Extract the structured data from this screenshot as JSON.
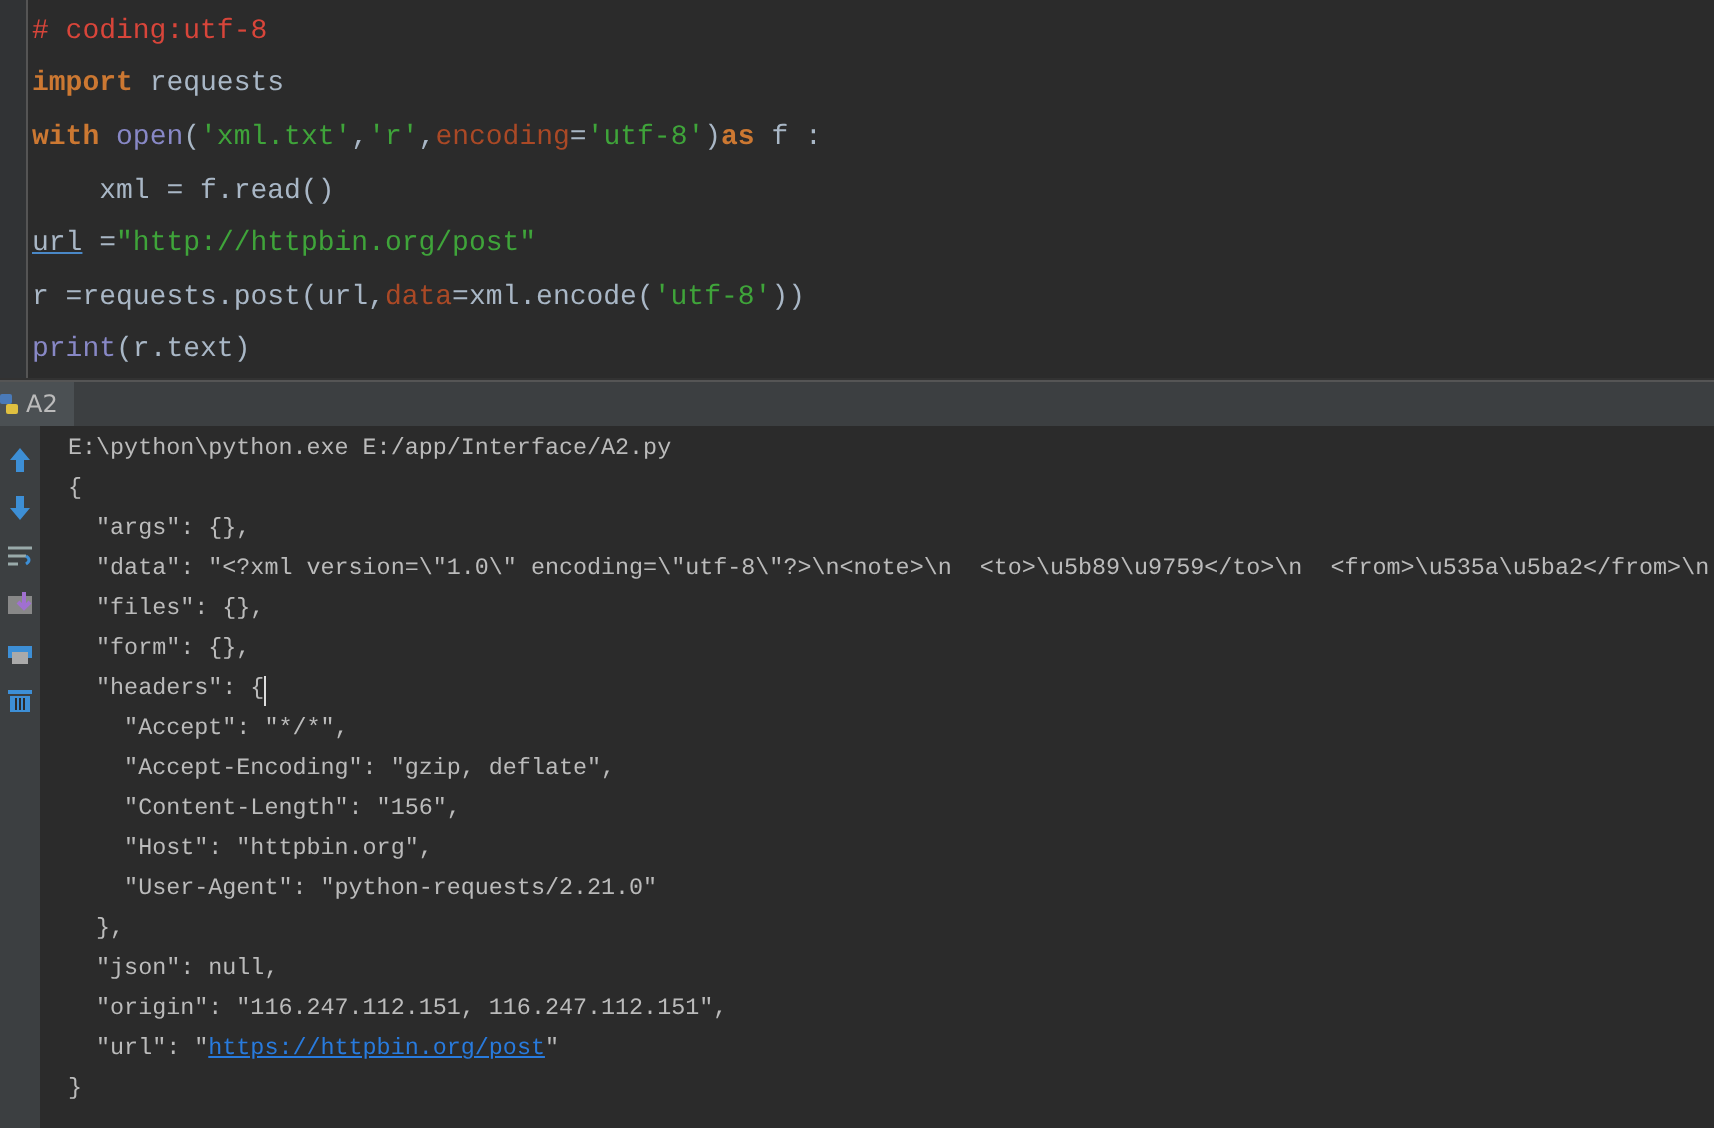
{
  "editor": {
    "lines": [
      [
        {
          "kind": "comment",
          "text": "# coding:utf-8"
        }
      ],
      [
        {
          "kind": "keyword",
          "text": "import"
        },
        {
          "kind": "plain",
          "text": " requests"
        }
      ],
      [
        {
          "kind": "keyword",
          "text": "with"
        },
        {
          "kind": "builtin",
          "text": " open"
        },
        {
          "kind": "plain",
          "text": "("
        },
        {
          "kind": "string",
          "text": "'xml.txt'"
        },
        {
          "kind": "plain",
          "text": ","
        },
        {
          "kind": "string",
          "text": "'r'"
        },
        {
          "kind": "plain",
          "text": ","
        },
        {
          "kind": "param",
          "text": "encoding"
        },
        {
          "kind": "plain",
          "text": "="
        },
        {
          "kind": "string",
          "text": "'utf-8'"
        },
        {
          "kind": "plain",
          "text": ")"
        },
        {
          "kind": "keyword",
          "text": "as"
        },
        {
          "kind": "plain",
          "text": " f :"
        }
      ],
      [
        {
          "kind": "plain",
          "text": "    xml = f.read()"
        }
      ],
      [
        {
          "kind": "warning",
          "text": "url"
        },
        {
          "kind": "plain",
          "text": " ="
        },
        {
          "kind": "string",
          "text": "\"http://httpbin.org/post\""
        }
      ],
      [
        {
          "kind": "plain",
          "text": "r =requests.post(url,"
        },
        {
          "kind": "param",
          "text": "data"
        },
        {
          "kind": "plain",
          "text": "=xml.encode("
        },
        {
          "kind": "string",
          "text": "'utf-8'"
        },
        {
          "kind": "plain",
          "text": "))"
        }
      ],
      [
        {
          "kind": "builtin",
          "text": "print"
        },
        {
          "kind": "plain",
          "text": "(r.text)"
        }
      ]
    ]
  },
  "run_panel": {
    "tab": {
      "label": "A2",
      "selected": true
    },
    "lines": [
      {
        "cursor": false,
        "parts": [
          {
            "kind": "text",
            "text": "E:\\python\\python.exe E:/app/Interface/A2.py"
          }
        ]
      },
      {
        "cursor": false,
        "parts": [
          {
            "kind": "text",
            "text": "{"
          }
        ]
      },
      {
        "cursor": false,
        "parts": [
          {
            "kind": "text",
            "text": "  \"args\": {},"
          }
        ]
      },
      {
        "cursor": false,
        "parts": [
          {
            "kind": "text",
            "text": "  \"data\": \"<?xml version=\\\"1.0\\\" encoding=\\\"utf-8\\\"?>\\n<note>\\n  <to>\\u5b89\\u9759</to>\\n  <from>\\u535a\\u5ba2</from>\\n"
          }
        ]
      },
      {
        "cursor": false,
        "parts": [
          {
            "kind": "text",
            "text": "  \"files\": {},"
          }
        ]
      },
      {
        "cursor": false,
        "parts": [
          {
            "kind": "text",
            "text": "  \"form\": {},"
          }
        ]
      },
      {
        "cursor": true,
        "parts": [
          {
            "kind": "text",
            "text": "  \"headers\": {"
          }
        ]
      },
      {
        "cursor": false,
        "parts": [
          {
            "kind": "text",
            "text": "    \"Accept\": \"*/*\","
          }
        ]
      },
      {
        "cursor": false,
        "parts": [
          {
            "kind": "text",
            "text": "    \"Accept-Encoding\": \"gzip, deflate\","
          }
        ]
      },
      {
        "cursor": false,
        "parts": [
          {
            "kind": "text",
            "text": "    \"Content-Length\": \"156\","
          }
        ]
      },
      {
        "cursor": false,
        "parts": [
          {
            "kind": "text",
            "text": "    \"Host\": \"httpbin.org\","
          }
        ]
      },
      {
        "cursor": false,
        "parts": [
          {
            "kind": "text",
            "text": "    \"User-Agent\": \"python-requests/2.21.0\""
          }
        ]
      },
      {
        "cursor": false,
        "parts": [
          {
            "kind": "text",
            "text": "  },"
          }
        ]
      },
      {
        "cursor": false,
        "parts": [
          {
            "kind": "text",
            "text": "  \"json\": null,"
          }
        ]
      },
      {
        "cursor": false,
        "parts": [
          {
            "kind": "text",
            "text": "  \"origin\": \"116.247.112.151, 116.247.112.151\","
          }
        ]
      },
      {
        "cursor": false,
        "parts": [
          {
            "kind": "text",
            "text": "  \"url\": \""
          },
          {
            "kind": "link",
            "text": "https://httpbin.org/post"
          },
          {
            "kind": "text",
            "text": "\""
          }
        ]
      },
      {
        "cursor": false,
        "parts": [
          {
            "kind": "text",
            "text": "}"
          }
        ]
      }
    ]
  }
}
